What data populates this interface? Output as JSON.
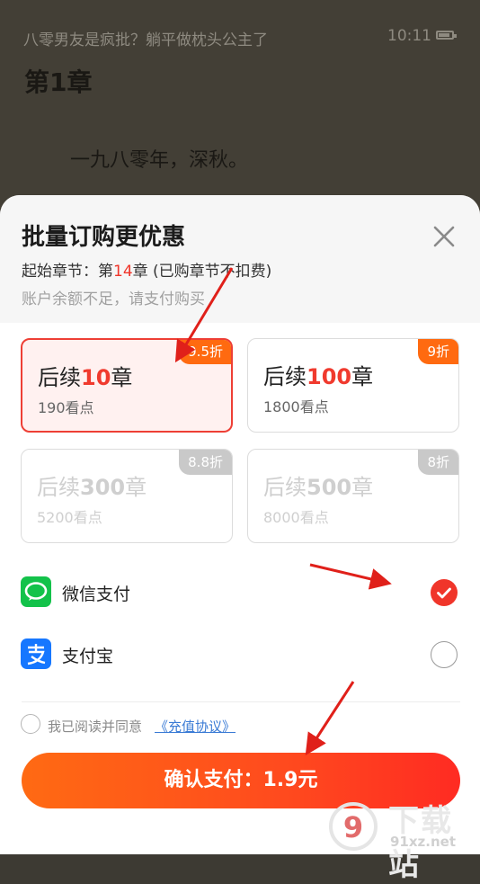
{
  "reader": {
    "book_title": "八零男友是疯批？躺平做枕头公主了",
    "time": "10:11",
    "chapter_title": "第1章",
    "first_line": "一九八零年，深秋。"
  },
  "sheet": {
    "title": "批量订购更优惠",
    "start_prefix": "起始章节：第",
    "start_chapter": "14",
    "start_suffix": "章 (已购章节不扣费)",
    "balance_notice": "账户余额不足，请支付购买"
  },
  "packages": [
    {
      "prefix": "后续",
      "count": "10",
      "suffix": "章",
      "price": "190看点",
      "discount": "9.5折",
      "state": "selected"
    },
    {
      "prefix": "后续",
      "count": "100",
      "suffix": "章",
      "price": "1800看点",
      "discount": "9折",
      "state": "normal"
    },
    {
      "prefix": "后续",
      "count": "300",
      "suffix": "章",
      "price": "5200看点",
      "discount": "8.8折",
      "state": "disabled"
    },
    {
      "prefix": "后续",
      "count": "500",
      "suffix": "章",
      "price": "8000看点",
      "discount": "8折",
      "state": "disabled"
    }
  ],
  "payment": {
    "methods": [
      {
        "label": "微信支付",
        "icon": "wechat-icon",
        "selected": true
      },
      {
        "label": "支付宝",
        "icon": "alipay-icon",
        "selected": false
      }
    ]
  },
  "agreement": {
    "text": "我已阅读并同意",
    "link": "《充值协议》",
    "checked": false
  },
  "confirm_label": "确认支付：1.9元",
  "watermark": {
    "text": "下载站",
    "domain": "91xz.net"
  },
  "colors": {
    "accent": "#f0352a",
    "button_start": "#ff6a13",
    "button_end": "#ff2b22",
    "wechat": "#13c24a",
    "alipay": "#1677ff",
    "badge": "#ff6a10"
  }
}
